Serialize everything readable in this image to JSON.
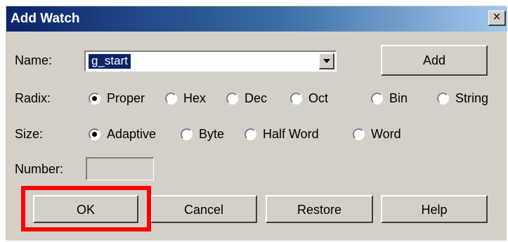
{
  "dialog": {
    "title": "Add Watch",
    "close_glyph": "×"
  },
  "name_row": {
    "label": "Name:",
    "value": "g_start",
    "add_label": "Add"
  },
  "radix": {
    "label": "Radix:",
    "options": [
      "Proper",
      "Hex",
      "Dec",
      "Oct",
      "Bin",
      "String"
    ],
    "selected": "Proper"
  },
  "size": {
    "label": "Size:",
    "options": [
      "Adaptive",
      "Byte",
      "Half Word",
      "Word"
    ],
    "selected": "Adaptive"
  },
  "number": {
    "label": "Number:",
    "value": ""
  },
  "buttons": {
    "ok": "OK",
    "cancel": "Cancel",
    "restore": "Restore",
    "help": "Help"
  },
  "highlight_color": "#ff0000"
}
